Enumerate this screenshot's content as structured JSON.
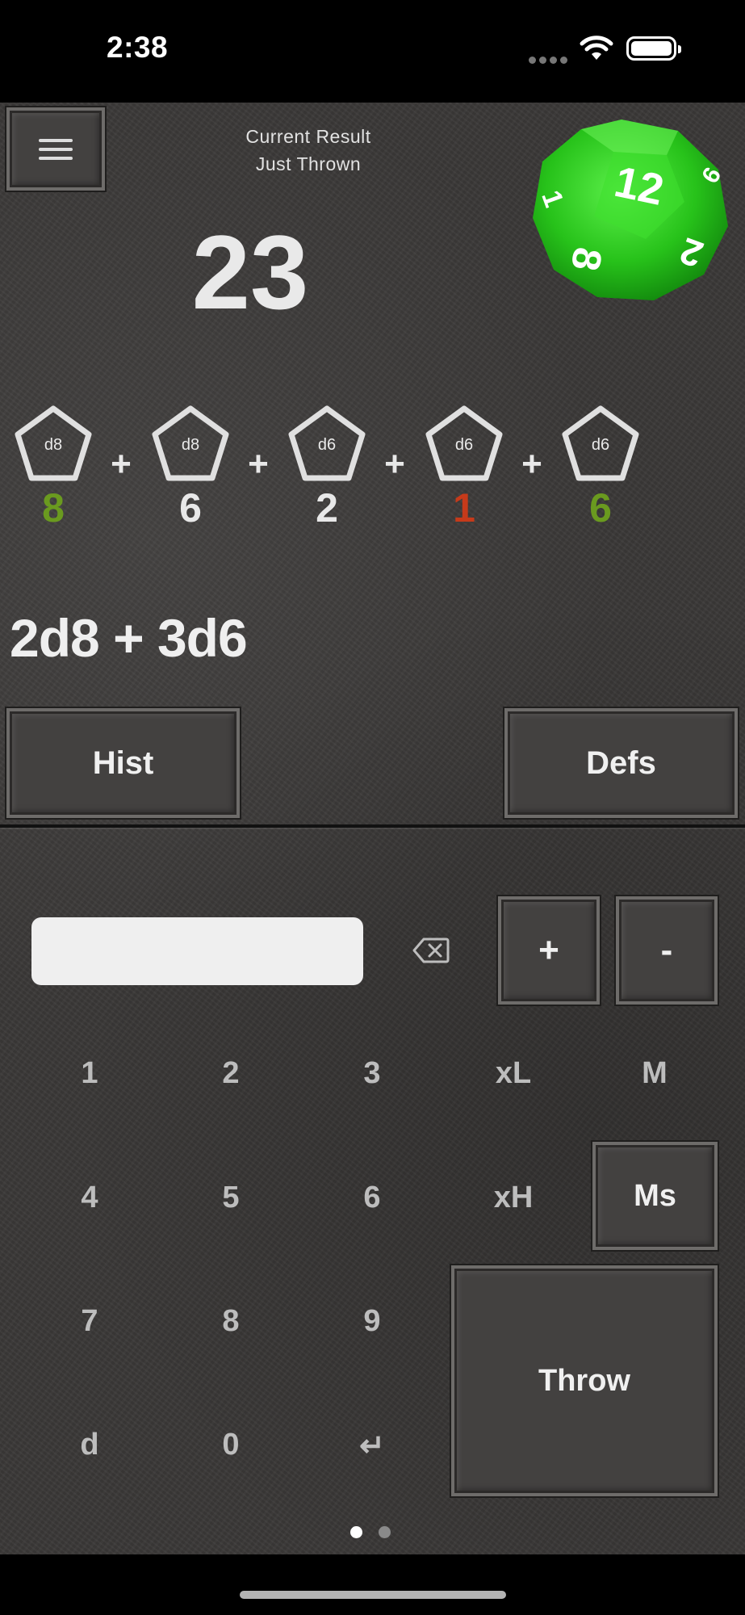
{
  "status": {
    "time": "2:38"
  },
  "header": {
    "caption_line1": "Current Result",
    "caption_line2": "Just Thrown",
    "result": "23"
  },
  "dice": [
    {
      "type": "d8",
      "value": "8",
      "color": "#6a9a1f"
    },
    {
      "type": "d8",
      "value": "6",
      "color": "#e8e8e8"
    },
    {
      "type": "d6",
      "value": "2",
      "color": "#e8e8e8"
    },
    {
      "type": "d6",
      "value": "1",
      "color": "#c63a1a"
    },
    {
      "type": "d6",
      "value": "6",
      "color": "#6a9a1f"
    }
  ],
  "dice_operator": "+",
  "formula": "2d8 + 3d6",
  "buttons": {
    "hist": "Hist",
    "defs": "Defs",
    "plus": "+",
    "minus": "-",
    "ms": "Ms",
    "throw": "Throw"
  },
  "input": {
    "value": ""
  },
  "keypad": {
    "row1": [
      "1",
      "2",
      "3",
      "xL",
      "M"
    ],
    "row2": [
      "4",
      "5",
      "6",
      "xH"
    ],
    "row3": [
      "7",
      "8",
      "9"
    ],
    "row4": [
      "d",
      "0",
      "↵"
    ]
  },
  "page_indicator": {
    "count": 2,
    "active": 1
  },
  "colors": {
    "background": "#3a3837",
    "die_green": "#27c21a",
    "high_roll": "#6a9a1f",
    "low_roll": "#c63a1a"
  },
  "icons": [
    "menu-icon",
    "d12-die-icon",
    "backspace-icon",
    "wifi-icon",
    "battery-icon"
  ]
}
